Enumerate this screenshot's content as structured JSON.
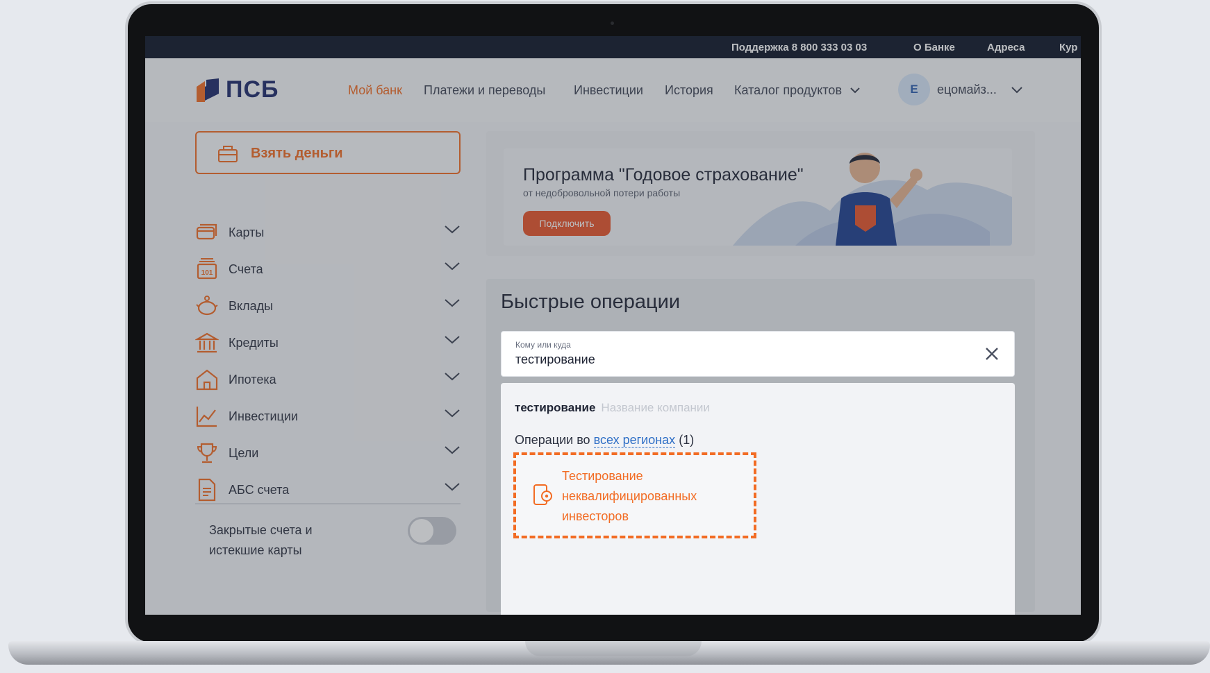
{
  "topbar": {
    "support": "Поддержка 8 800 333 03 03",
    "about": "О Банке",
    "addresses": "Адреса",
    "rates": "Кур"
  },
  "header": {
    "logo_text": "ПСБ",
    "nav": [
      "Мой банк",
      "Платежи и переводы",
      "Инвестиции",
      "История",
      "Каталог продуктов"
    ],
    "user_initial": "Е",
    "user_name": "ецомайз..."
  },
  "sidebar": {
    "take_money": "Взять деньги",
    "items": [
      {
        "label": "Карты",
        "icon": "cards-icon"
      },
      {
        "label": "Счета",
        "icon": "accounts-icon"
      },
      {
        "label": "Вклады",
        "icon": "piggy-bank-icon"
      },
      {
        "label": "Кредиты",
        "icon": "bank-building-icon"
      },
      {
        "label": "Ипотека",
        "icon": "house-icon"
      },
      {
        "label": "Инвестиции",
        "icon": "chart-icon"
      },
      {
        "label": "Цели",
        "icon": "trophy-icon"
      },
      {
        "label": "АБС счета",
        "icon": "document-icon"
      }
    ],
    "closed_accounts": "Закрытые счета и истекшие карты",
    "closed_toggle_on": false
  },
  "promo": {
    "title": "Программа \"Годовое страхование\"",
    "subtitle": "от недобровольной потери работы",
    "button": "Подключить"
  },
  "quick_ops": {
    "title": "Быстрые операции",
    "search_hint": "Кому или куда",
    "search_value": "тестирование",
    "dropdown": {
      "query": "тестирование",
      "placeholder": "Название компании",
      "regions_prefix": "Операции во",
      "regions_link": "всех регионах",
      "regions_count": "(1)",
      "result": "Тестирование неквалифицированных инвесторов"
    }
  },
  "colors": {
    "accent": "#f26c24",
    "brand_navy": "#1d2a6b",
    "link": "#2f6fc6"
  }
}
